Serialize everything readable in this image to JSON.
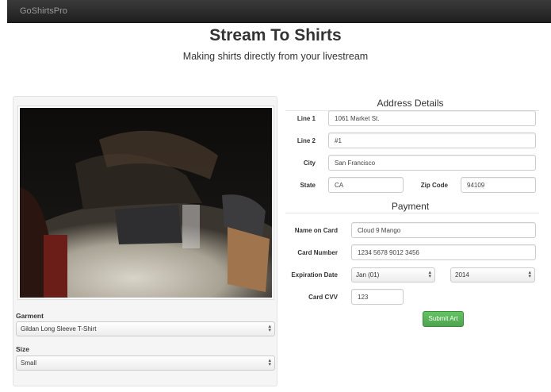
{
  "navbar": {
    "brand": "GoShirtsPro"
  },
  "header": {
    "title": "Stream To Shirts",
    "subtitle": "Making shirts directly from your livestream"
  },
  "garment": {
    "label": "Garment",
    "selected": "Gildan Long Sleeve T-Shirt"
  },
  "size": {
    "label": "Size",
    "selected": "Small"
  },
  "address": {
    "heading": "Address Details",
    "line1_label": "Line 1",
    "line1_value": "1061 Market St.",
    "line2_label": "Line 2",
    "line2_value": "#1",
    "city_label": "City",
    "city_value": "San Francisco",
    "state_label": "State",
    "state_value": "CA",
    "zip_label": "Zip Code",
    "zip_value": "94109"
  },
  "payment": {
    "heading": "Payment",
    "name_label": "Name on Card",
    "name_value": "Cloud 9 Mango",
    "card_label": "Card Number",
    "card_value": "1234 5678 9012 3456",
    "exp_label": "Expiration Date",
    "exp_month": "Jan (01)",
    "exp_year": "2014",
    "cvv_label": "Card CVV",
    "cvv_value": "123"
  },
  "submit_label": "Submit Art",
  "colors": {
    "accent_green": "#51a351",
    "navbar": "#2a2a2a"
  }
}
